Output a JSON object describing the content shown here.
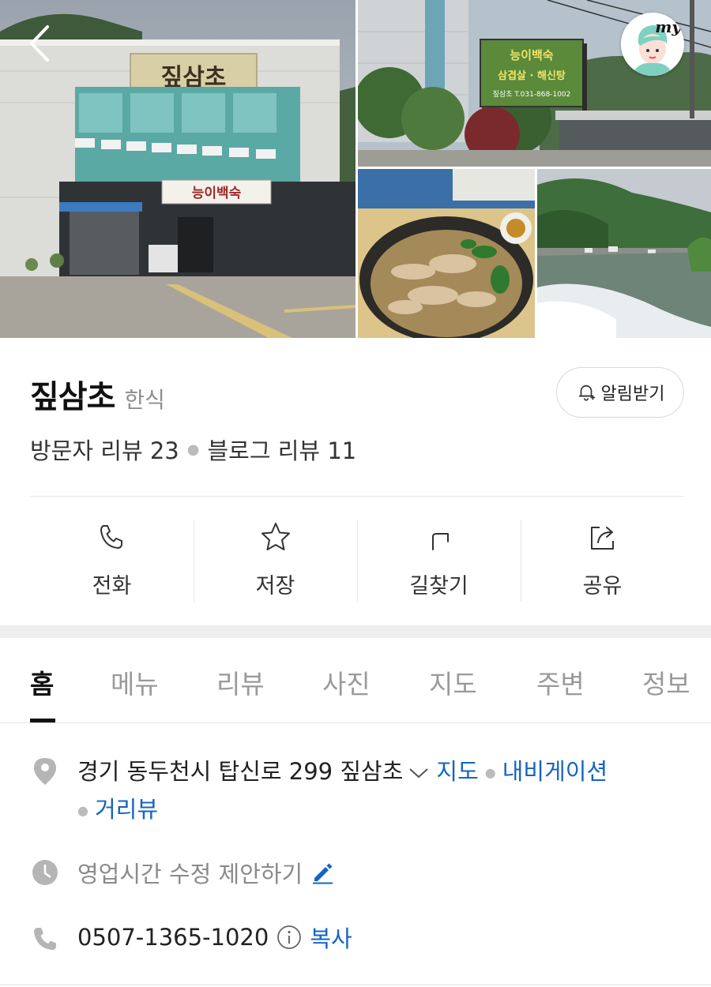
{
  "place": {
    "name": "짚삼초",
    "category": "한식",
    "visitor_review_label": "방문자 리뷰",
    "visitor_review_count": "23",
    "blog_review_label": "블로그 리뷰",
    "blog_review_count": "11"
  },
  "alarm_button": "알림받기",
  "my_button": "my",
  "photo_signs": {
    "main_building": "짚삼초",
    "main_banner": "능이백숙",
    "sign_line1": "능이백숙",
    "sign_line2": "삼겹살 · 해신탕",
    "sign_line3": "짚삼초  T.031-868-1002"
  },
  "actions": [
    {
      "label": "전화",
      "icon": "phone-icon"
    },
    {
      "label": "저장",
      "icon": "star-icon"
    },
    {
      "label": "길찾기",
      "icon": "directions-icon"
    },
    {
      "label": "공유",
      "icon": "share-icon"
    }
  ],
  "tabs": [
    "홈",
    "메뉴",
    "리뷰",
    "사진",
    "지도",
    "주변",
    "정보"
  ],
  "active_tab": "홈",
  "address": {
    "text": "경기 동두천시 탑신로 299 짚삼초",
    "map_link": "지도",
    "navigation_link": "내비게이션",
    "street_view_link": "거리뷰"
  },
  "hours": {
    "text": "영업시간 수정 제안하기"
  },
  "phone": {
    "number": "0507-1365-1020",
    "copy_link": "복사"
  },
  "colors": {
    "link": "#1565c0",
    "icon_gray": "#b5b5b5"
  }
}
